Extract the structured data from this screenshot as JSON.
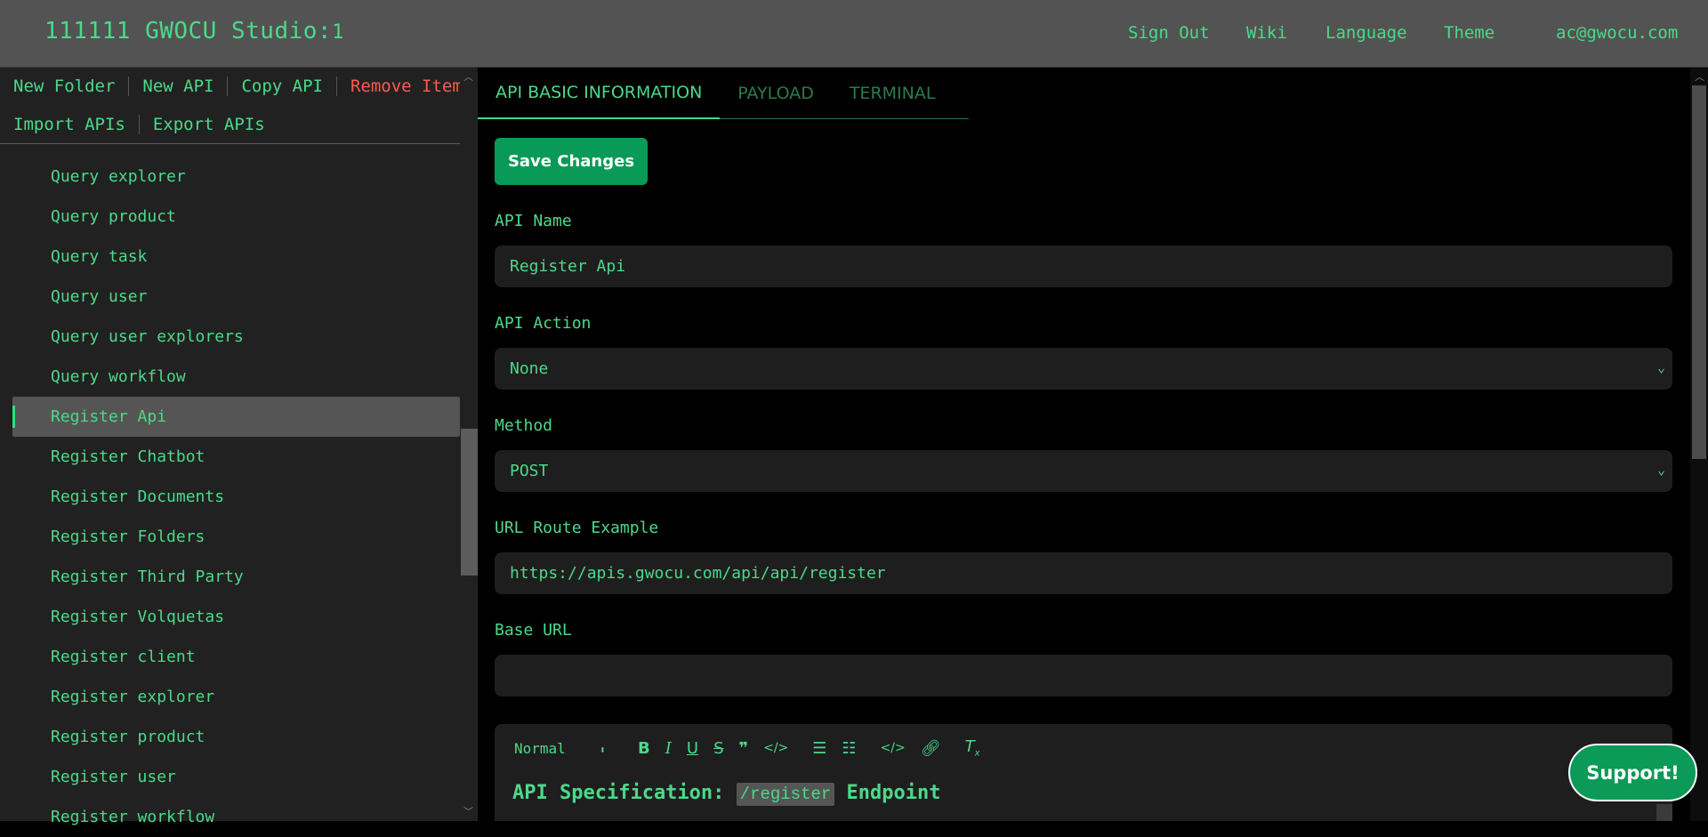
{
  "header": {
    "title": "111111 GWOCU Studio:",
    "version": "1",
    "links": [
      "Sign Out",
      "Wiki",
      "Language",
      "Theme"
    ],
    "user_email": "ac@gwocu.com"
  },
  "sidebar": {
    "toolbar_row1": [
      "New Folder",
      "New API",
      "Copy API",
      "Remove Item"
    ],
    "toolbar_row2": [
      "Import APIs",
      "Export APIs"
    ],
    "items": [
      "Query explorer",
      "Query product",
      "Query task",
      "Query user",
      "Query user explorers",
      "Query workflow",
      "Register Api",
      "Register Chatbot",
      "Register Documents",
      "Register Folders",
      "Register Third Party",
      "Register Volquetas",
      "Register client",
      "Register explorer",
      "Register product",
      "Register user",
      "Register workflow"
    ],
    "selected": "Register Api"
  },
  "tabs": [
    "API BASIC INFORMATION",
    "PAYLOAD",
    "TERMINAL"
  ],
  "active_tab": "API BASIC INFORMATION",
  "form": {
    "save_label": "Save Changes",
    "api_name_label": "API Name",
    "api_name_value": "Register Api",
    "api_action_label": "API Action",
    "api_action_value": "None",
    "method_label": "Method",
    "method_value": "POST",
    "url_route_label": "URL Route Example",
    "url_route_value": "https://apis.gwocu.com/api/api/register",
    "base_url_label": "Base URL",
    "base_url_value": ""
  },
  "editor": {
    "format_select": "Normal",
    "content_prefix": "API Specification: ",
    "content_code": "/register",
    "content_suffix": " Endpoint"
  },
  "support_label": "Support!",
  "colors": {
    "accent": "#3ddc84",
    "header_bg": "#535353",
    "sidebar_bg": "#212121",
    "danger": "#ff5a4e",
    "button_green": "#0a9a58"
  }
}
